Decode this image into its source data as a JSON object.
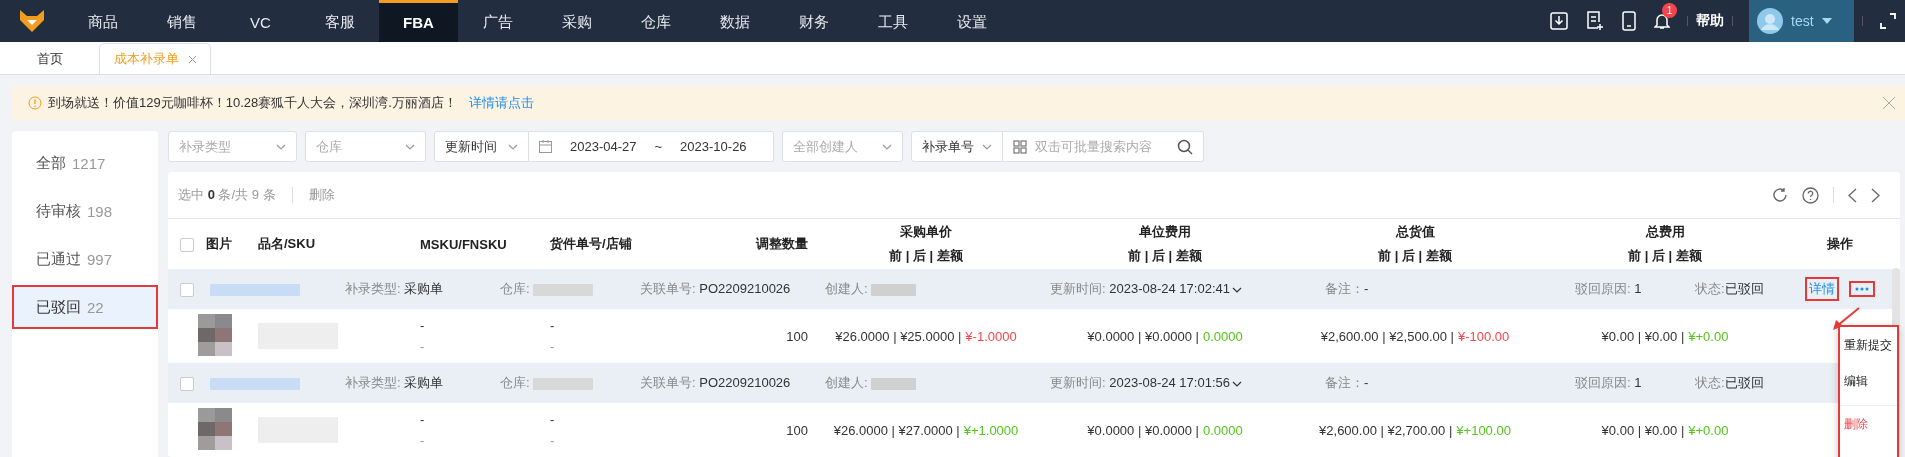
{
  "nav": {
    "items": [
      {
        "label": "商品",
        "selected": false
      },
      {
        "label": "销售",
        "selected": false
      },
      {
        "label": "VC",
        "selected": false
      },
      {
        "label": "客服",
        "selected": false
      },
      {
        "label": "FBA",
        "selected": true
      },
      {
        "label": "广告",
        "selected": false
      },
      {
        "label": "采购",
        "selected": false
      },
      {
        "label": "仓库",
        "selected": false
      },
      {
        "label": "数据",
        "selected": false
      },
      {
        "label": "财务",
        "selected": false
      },
      {
        "label": "工具",
        "selected": false
      },
      {
        "label": "设置",
        "selected": false
      }
    ],
    "notification_count": "1",
    "help": "帮助",
    "user": "test"
  },
  "tabs": [
    {
      "label": "首页",
      "selected": false,
      "closable": false
    },
    {
      "label": "成本补录单",
      "selected": true,
      "closable": true
    }
  ],
  "notice": {
    "text": "到场就送！价值129元咖啡杯！10.28赛狐千人大会，深圳湾.万丽酒店！",
    "link": "详情请点击"
  },
  "sidebar": {
    "items": [
      {
        "label": "全部",
        "count": "1217",
        "selected": false,
        "highlighted": false
      },
      {
        "label": "待审核",
        "count": "198",
        "selected": false,
        "highlighted": false
      },
      {
        "label": "已通过",
        "count": "997",
        "selected": false,
        "highlighted": false
      },
      {
        "label": "已驳回",
        "count": "22",
        "selected": true,
        "highlighted": true
      }
    ]
  },
  "filters": [
    {
      "kind": "select",
      "placeholder": "补录类型"
    },
    {
      "kind": "select",
      "placeholder": "仓库"
    },
    {
      "kind": "date_range",
      "field": "更新时间",
      "start": "2023-04-27",
      "separator": "~",
      "end": "2023-10-26"
    },
    {
      "kind": "select",
      "placeholder": "全部创建人"
    },
    {
      "kind": "search",
      "field": "补录单号",
      "placeholder": "双击可批量搜索内容"
    }
  ],
  "toolbar": {
    "selection": "选中 **0** 条/共 9 条",
    "delete": "删除"
  },
  "table": {
    "select_all_checked": false,
    "columns": [
      {
        "label": "图片"
      },
      {
        "label": "品名/SKU"
      },
      {
        "label": "MSKU/FNSKU"
      },
      {
        "label": "货件单号/店铺"
      },
      {
        "label": "调整数量"
      },
      {
        "label": "采购单价",
        "sub": "前 | 后 | 差额"
      },
      {
        "label": "单位费用",
        "sub": "前 | 后 | 差额"
      },
      {
        "label": "总货值",
        "sub": "前 | 后 | 差额"
      },
      {
        "label": "总费用",
        "sub": "前 | 后 | 差额"
      },
      {
        "label": "操作"
      }
    ],
    "groups": [
      {
        "checked": false,
        "type_label": "补录类型:",
        "type": "采购单",
        "warehouse_label": "仓库:",
        "ref_label": "关联单号:",
        "ref": "PO2209210026",
        "creator_label": "创建人:",
        "updated_label": "更新时间:",
        "updated": "2023-08-24 17:02:41",
        "note_label": "备注：",
        "note": "-",
        "reason_label": "驳回原因:",
        "reason": "1",
        "status_label": "状态:",
        "status": "已驳回",
        "detail_link": "详情",
        "actions_highlighted": true,
        "item": {
          "msku": "-",
          "fnsku": "-",
          "shipment": "-",
          "store": "-",
          "quantity": "100",
          "prices": [
            {
              "base": "¥26.0000 | ¥25.0000 |",
              "diff": "¥-1.0000",
              "color": "#f5454a"
            },
            {
              "base": "¥0.0000 | ¥0.0000 |",
              "diff": "0.0000",
              "color": "#52c41a"
            },
            {
              "base": "¥2,600.00 | ¥2,500.00 |",
              "diff": "¥-100.00",
              "color": "#f5454a"
            },
            {
              "base": "¥0.00 | ¥0.00 |",
              "diff": "¥+0.00",
              "color": "#52c41a"
            }
          ]
        }
      },
      {
        "checked": false,
        "type_label": "补录类型:",
        "type": "采购单",
        "warehouse_label": "仓库:",
        "ref_label": "关联单号:",
        "ref": "PO2209210026",
        "creator_label": "创建人:",
        "updated_label": "更新时间:",
        "updated": "2023-08-24 17:01:56",
        "note_label": "备注：",
        "note": "-",
        "reason_label": "驳回原因:",
        "reason": "1",
        "status_label": "状态:",
        "status": "已驳回",
        "item": {
          "msku": "-",
          "fnsku": "-",
          "shipment": "-",
          "store": "-",
          "quantity": "100",
          "prices": [
            {
              "base": "¥26.0000 | ¥27.0000 |",
              "diff": "¥+1.0000",
              "color": "#52c41a"
            },
            {
              "base": "¥0.0000 | ¥0.0000 |",
              "diff": "0.0000",
              "color": "#52c41a"
            },
            {
              "base": "¥2,600.00 | ¥2,700.00 |",
              "diff": "¥+100.00",
              "color": "#52c41a"
            },
            {
              "base": "¥0.00 | ¥0.00 |",
              "diff": "¥+0.00",
              "color": "#52c41a"
            }
          ]
        }
      }
    ]
  },
  "action_menu": {
    "highlighted": true,
    "items": [
      {
        "label": "重新提交",
        "kind": "normal"
      },
      {
        "label": "编辑",
        "kind": "normal"
      },
      {
        "label": "删除",
        "kind": "danger"
      }
    ]
  }
}
